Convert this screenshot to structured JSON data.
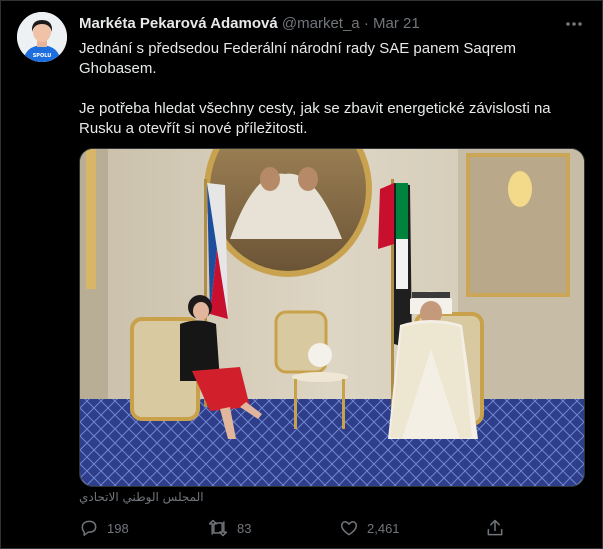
{
  "tweet": {
    "author_name": "Markéta Pekarová Adamová",
    "handle": "@market_a",
    "separator": "·",
    "date": "Mar 21",
    "paragraphs": [
      "Jednání s předsedou Federální národní rady SAE panem Saqrem Ghobasem.",
      "Je potřeba hledat všechny cesty, jak se zbavit energetické závislosti na Rusku a otevřít si nové příležitosti."
    ],
    "photo_watermark": "المجلس الوطني الاتحادي",
    "actions": {
      "reply": {
        "icon": "reply-icon",
        "count": "198"
      },
      "retweet": {
        "icon": "retweet-icon",
        "count": "83"
      },
      "like": {
        "icon": "like-icon",
        "count": "2,461"
      },
      "share": {
        "icon": "share-icon"
      }
    },
    "avatar_badge": "SPOLU"
  },
  "colors": {
    "background": "#000000",
    "primary_text": "#e7e9ea",
    "secondary_text": "#71767b",
    "border": "#2f3336",
    "badge_blue": "#1d6fe0"
  }
}
